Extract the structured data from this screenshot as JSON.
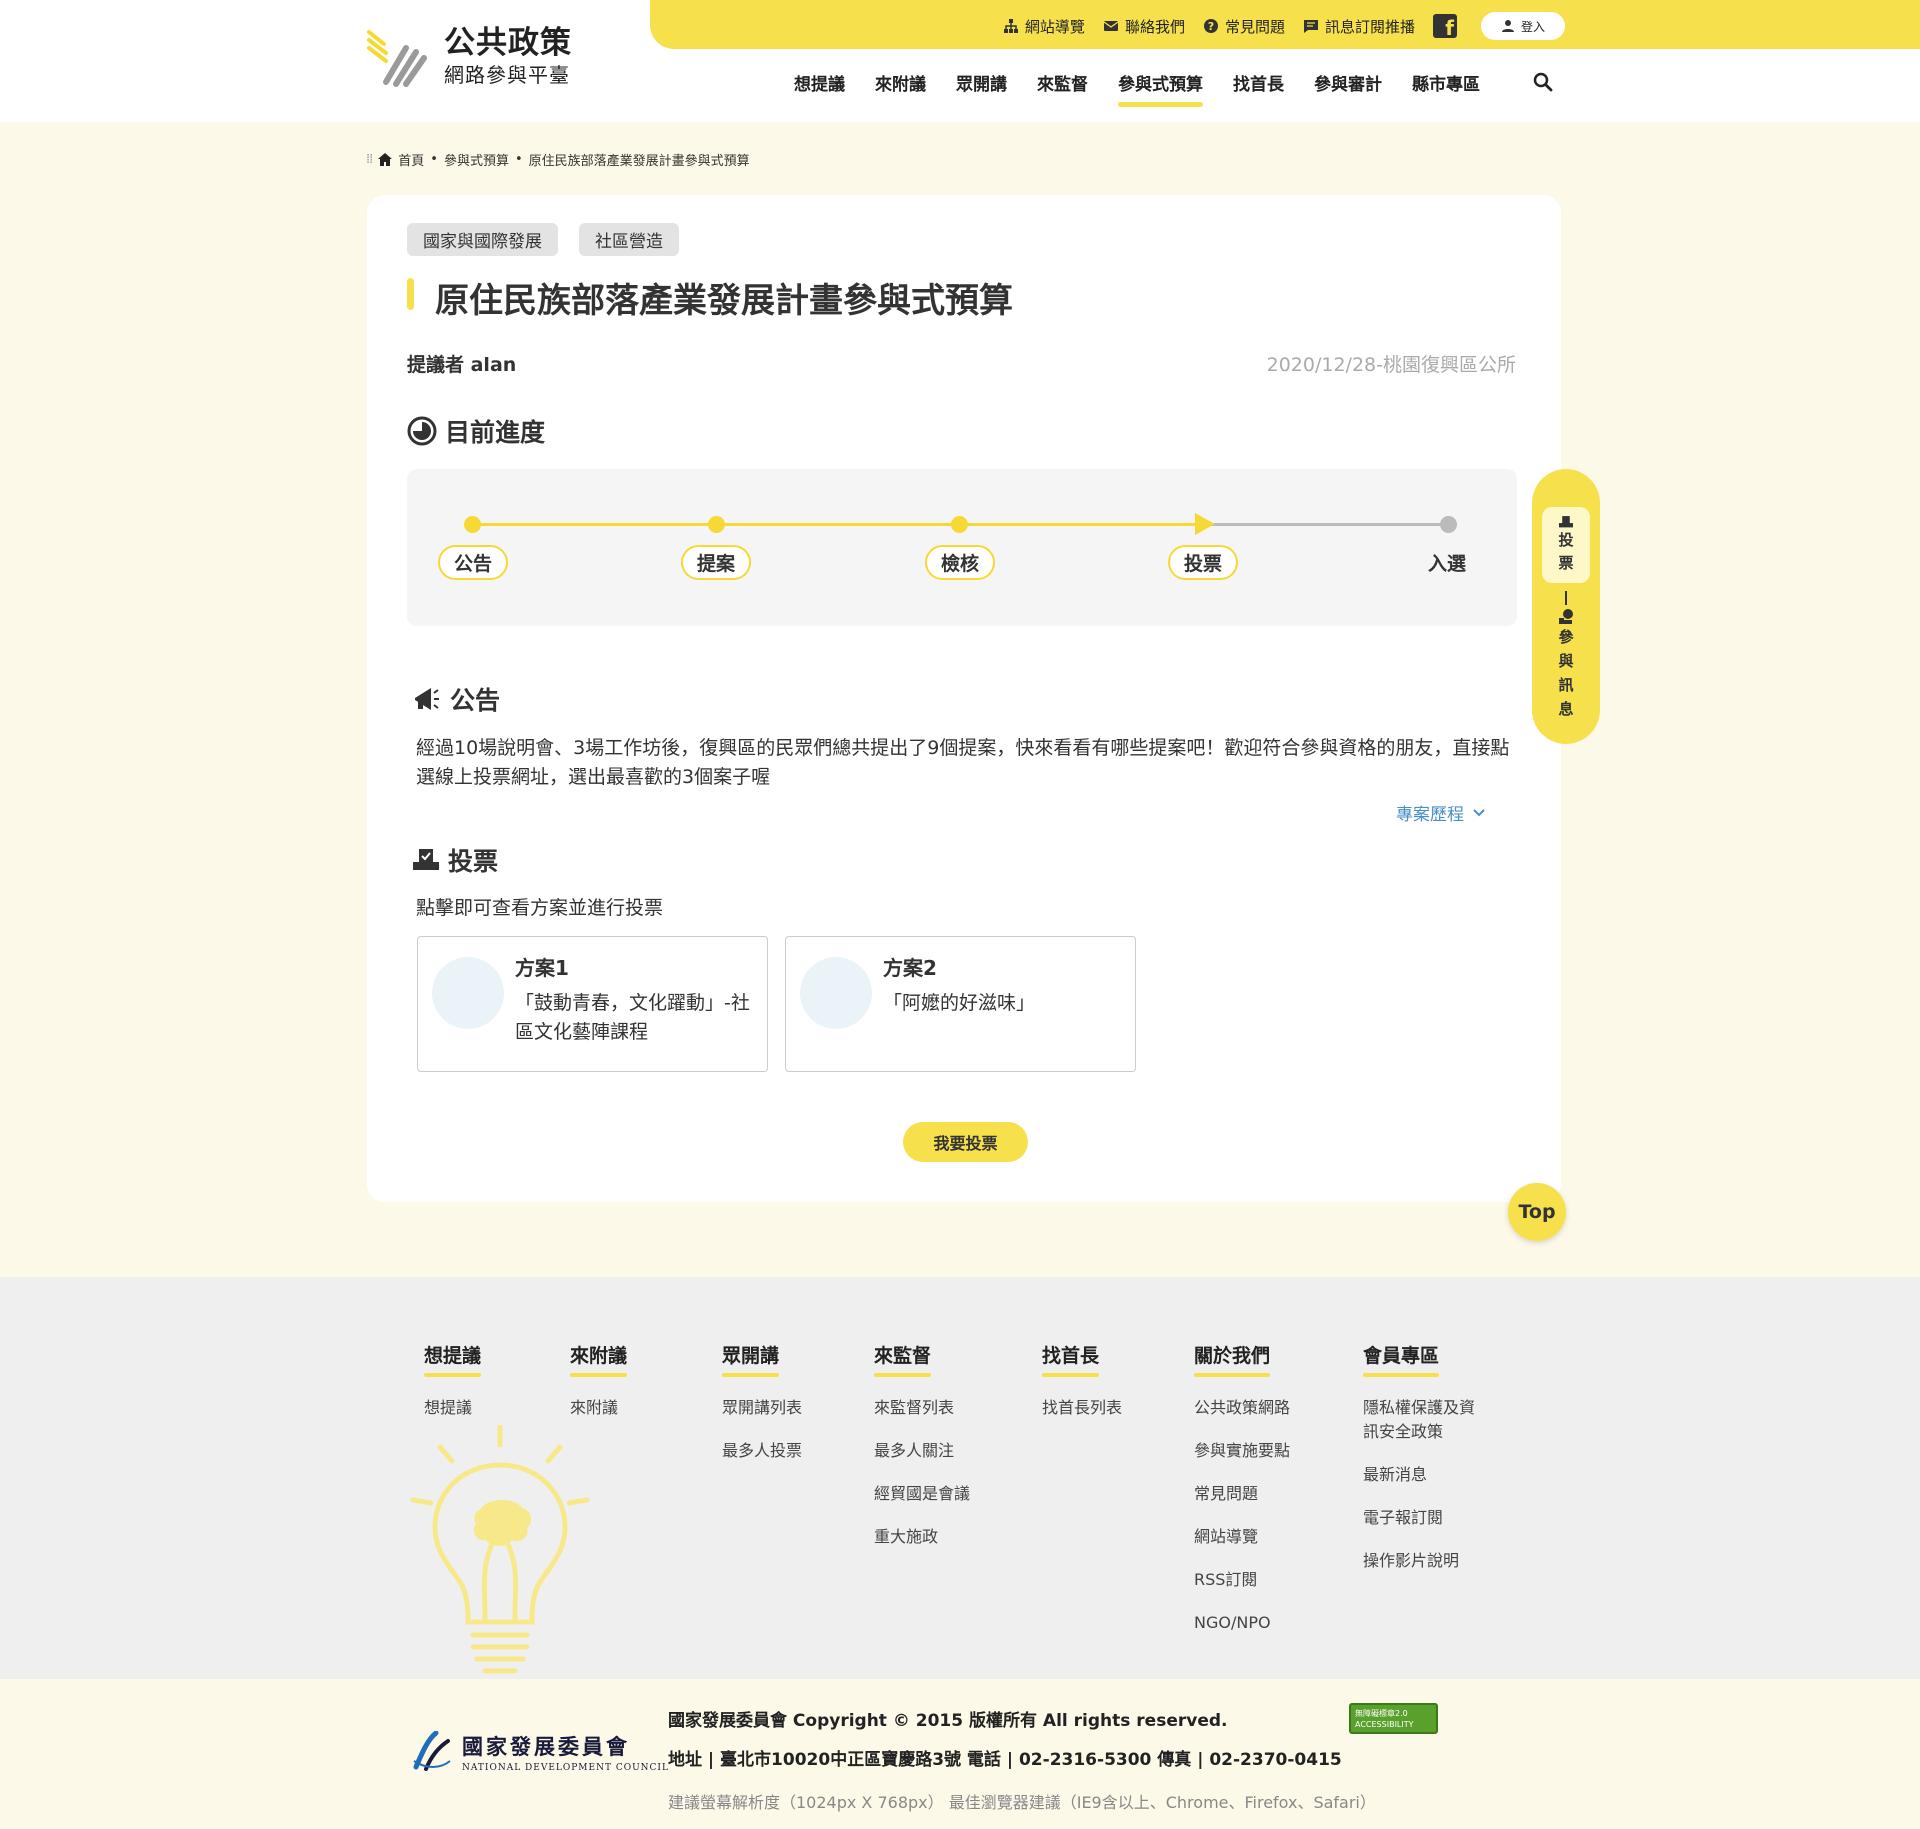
{
  "header": {
    "logo_title": "公共政策",
    "logo_sub": "網路參與平臺",
    "util": [
      {
        "label": "網站導覽",
        "icon": "sitemap-icon"
      },
      {
        "label": "聯絡我們",
        "icon": "mail-icon"
      },
      {
        "label": "常見問題",
        "icon": "question-icon"
      },
      {
        "label": "訊息訂閱推播",
        "icon": "message-icon"
      }
    ],
    "facebook_icon": "f",
    "login_label": "登入",
    "nav": [
      "想提議",
      "來附議",
      "眾開講",
      "來監督",
      "參與式預算",
      "找首長",
      "參與審計",
      "縣市專區"
    ],
    "active_nav": "參與式預算"
  },
  "breadcrumb": {
    "home": "首頁",
    "items": [
      "參與式預算",
      "原住民族部落產業發展計畫參與式預算"
    ]
  },
  "card": {
    "tags": [
      "國家與國際發展",
      "社區營造"
    ],
    "title": "原住民族部落產業發展計畫參與式預算",
    "proposer": "提議者  alan",
    "date_location": "2020/12/28-桃園復興區公所",
    "progress_heading": "目前進度",
    "steps": [
      "公告",
      "提案",
      "檢核",
      "投票",
      "入選"
    ],
    "current_step_index": 3,
    "announce_heading": "公告",
    "announce_text": "經過10場說明會、3場工作坊後，復興區的民眾們總共提出了9個提案，快來看看有哪些提案吧！歡迎符合參與資格的朋友，直接點選線上投票網址，選出最喜歡的3個案子喔",
    "history_link": "專案歷程",
    "vote_heading": "投票",
    "vote_desc": "點擊即可查看方案並進行投票",
    "plans": [
      {
        "title": "方案1",
        "desc": "「鼓動青春，文化躍動」-社區文化藝陣課程"
      },
      {
        "title": "方案2",
        "desc": "「阿嬤的好滋味」"
      }
    ],
    "vote_button": "我要投票"
  },
  "side_tab": {
    "vote_label": [
      "投",
      "票"
    ],
    "info_label": [
      "參",
      "與",
      "訊",
      "息"
    ]
  },
  "top_button": "Top",
  "footer": {
    "columns": [
      {
        "head": "想提議",
        "items": [
          "想提議"
        ]
      },
      {
        "head": "來附議",
        "items": [
          "來附議"
        ]
      },
      {
        "head": "眾開講",
        "items": [
          "眾開講列表",
          "最多人投票"
        ]
      },
      {
        "head": "來監督",
        "items": [
          "來監督列表",
          "最多人關注",
          "經貿國是會議",
          "重大施政"
        ]
      },
      {
        "head": "找首長",
        "items": [
          "找首長列表"
        ]
      },
      {
        "head": "關於我們",
        "items": [
          "公共政策網路",
          "參與實施要點",
          "常見問題",
          "網站導覽",
          "RSS訂閱",
          "NGO/NPO"
        ]
      },
      {
        "head": "會員專區",
        "items": [
          "隱私權保護及資訊安全政策",
          "最新消息",
          "電子報訂閱",
          "操作影片說明"
        ]
      }
    ],
    "org_cn": "國家發展委員會",
    "org_en": "NATIONAL DEVELOPMENT COUNCIL",
    "copyright": "國家發展委員會 Copyright © 2015 版權所有 All rights reserved.",
    "address": "地址 | 臺北市10020中正區寶慶路3號 電話 | 02-2316-5300 傳真 | 02-2370-0415",
    "recommend": "建議螢幕解析度（1024px X 768px）   最佳瀏覽器建議（IE9含以上、Chrome、Firefox、Safari）",
    "a11y_line1": "無障礙標章2.0",
    "a11y_line2": "ACCESSIBILITY"
  },
  "colors": {
    "accent": "#f6e14d",
    "page_bg": "#fdf9e8",
    "link": "#4a90c8"
  }
}
